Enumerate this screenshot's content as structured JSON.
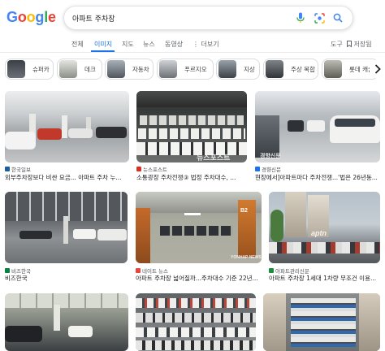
{
  "logo": {
    "letters": [
      "G",
      "o",
      "o",
      "g",
      "l",
      "e"
    ]
  },
  "search": {
    "query": "아파트 주차장"
  },
  "icons": {
    "mic": "mic-icon",
    "lens": "lens-icon",
    "search": "search-icon",
    "clear": "clear-icon"
  },
  "tabs": [
    "전체",
    "이미지",
    "지도",
    "뉴스",
    "동영상",
    "더보기"
  ],
  "tools": {
    "tools_label": "도구",
    "saved_label": "저장됨"
  },
  "chips": [
    "슈퍼카",
    "데크",
    "자동차",
    "푸르지오",
    "지상",
    "주상 복합",
    "롯데 캐슬"
  ],
  "results": [
    {
      "source": "한국일보",
      "title": "외부주차장보다 비싼 요금... 아파트 주차 누..."
    },
    {
      "source": "뉴스포스트",
      "title": "소통광장 주차전쟁③ 법정 주차대수, ...",
      "watermark": "뉴스포스트"
    },
    {
      "source": "경향신문",
      "title": "현장에서]아파트마다 주차전쟁...'법은 26년동...",
      "watermark": "경향신문"
    },
    {
      "source": "비즈한국",
      "title": "비즈한국"
    },
    {
      "source": "네이트 뉴스",
      "title": "아파트 주차장 넓어질까...주차대수 기준 22년...",
      "watermark": "YONHAP NEWS",
      "badge": "B2"
    },
    {
      "source": "아파트관리신문",
      "title": "아파트 주차장 1세대 1차량 무조건 이용...",
      "watermark": "aptn"
    },
    {
      "source": "",
      "title": ""
    },
    {
      "source": "",
      "title": ""
    },
    {
      "source": "",
      "title": ""
    }
  ]
}
